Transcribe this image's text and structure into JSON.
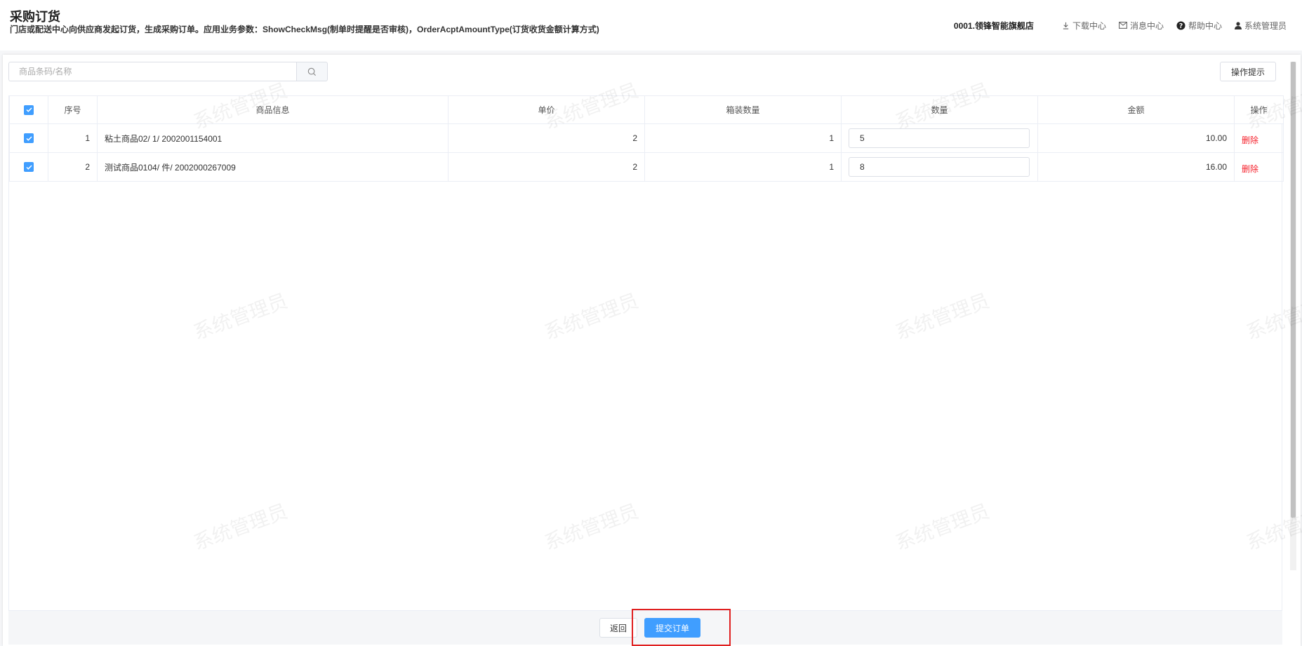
{
  "header": {
    "title": "采购订货",
    "description": "门店或配送中心向供应商发起订货，生成采购订单。应用业务参数：ShowCheckMsg(制单时提醒是否审核)，OrderAcptAmountType(订货收货金额计算方式)",
    "store": "0001.领锋智能旗舰店",
    "links": {
      "download": "下载中心",
      "messages": "消息中心",
      "help": "帮助中心",
      "user": "系统管理员"
    }
  },
  "toolbar": {
    "search_placeholder": "商品条码/名称",
    "tips_label": "操作提示"
  },
  "table": {
    "columns": [
      "序号",
      "商品信息",
      "单价",
      "箱装数量",
      "数量",
      "金额",
      "操作"
    ],
    "rows": [
      {
        "seq": "1",
        "product": "粘土商品02/ 1/ 2002001154001",
        "price": "2",
        "pack_qty": "1",
        "qty": "5",
        "amount": "10.00",
        "action": "删除"
      },
      {
        "seq": "2",
        "product": "测试商品0104/ 件/ 2002000267009",
        "price": "2",
        "pack_qty": "1",
        "qty": "8",
        "amount": "16.00",
        "action": "删除"
      }
    ]
  },
  "footer": {
    "back_label": "返回",
    "submit_label": "提交订单"
  },
  "watermark": "系统管理员",
  "colors": {
    "primary": "#409eff",
    "danger": "#f5222d",
    "highlight": "#e02020"
  }
}
